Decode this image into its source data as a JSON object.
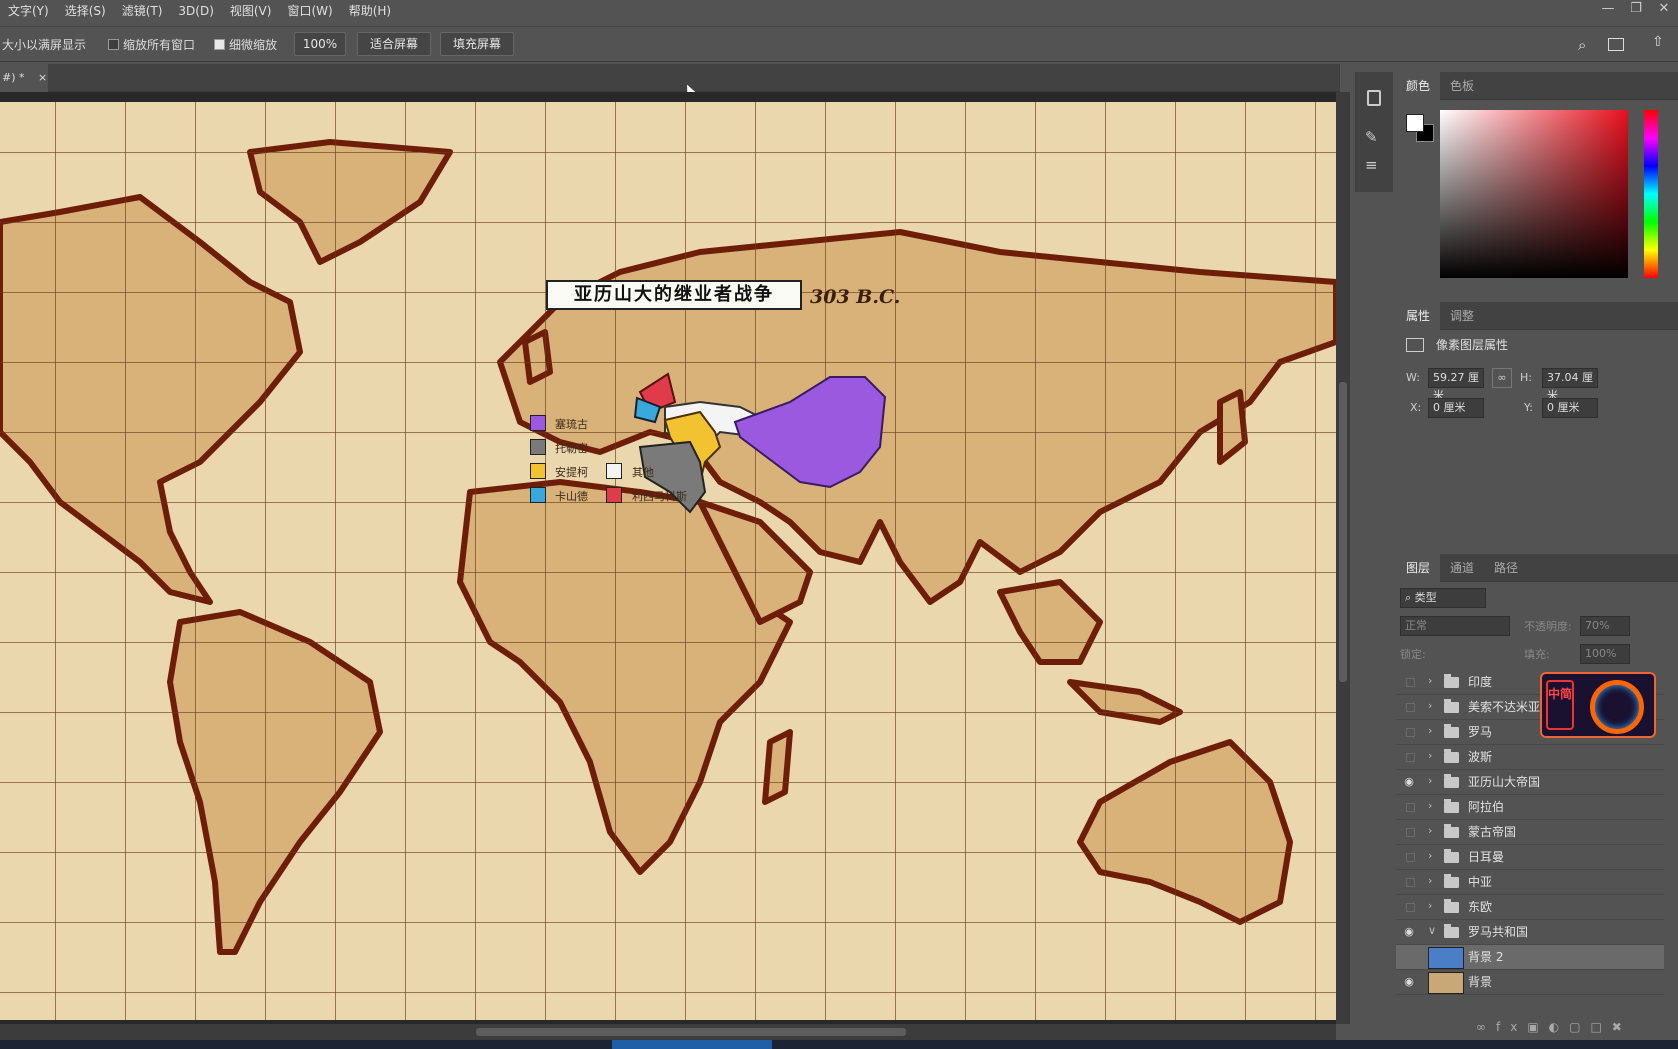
{
  "menu": [
    "文字(Y)",
    "选择(S)",
    "滤镜(T)",
    "3D(D)",
    "视图(V)",
    "窗口(W)",
    "帮助(H)"
  ],
  "window_controls": [
    "—",
    "❐",
    "✕"
  ],
  "options": {
    "resize_windows": "大小以满屏显示",
    "zoom_all": "缩放所有窗口",
    "scrubby": "细微缩放",
    "zoom_value": "100%",
    "fit_screen": "适合屏幕",
    "fill_screen": "填充屏幕"
  },
  "doc_tab": {
    "label": "#) *",
    "close": "×"
  },
  "map": {
    "title": "亚历山大的继业者战争",
    "date": "303 B.C.",
    "legend": [
      {
        "label": "塞琉古",
        "color": "#9b59e0"
      },
      {
        "label": "托勒密",
        "color": "#7a7a7a"
      },
      {
        "label": "安提柯",
        "color": "#f2c230"
      },
      {
        "label": "其他",
        "color": "#f4f4f4"
      },
      {
        "label": "卡山德",
        "color": "#3ba8dc"
      },
      {
        "label": "利西马科斯",
        "color": "#e03b4a"
      }
    ]
  },
  "color_panel": {
    "tabs": [
      "颜色",
      "色板"
    ]
  },
  "props_panel": {
    "tabs": [
      "属性",
      "调整"
    ],
    "heading": "像素图层属性",
    "w_label": "W:",
    "w_value": "59.27 厘米",
    "h_label": "H:",
    "h_value": "37.04 厘米",
    "x_label": "X:",
    "x_value": "0 厘米",
    "y_label": "Y:",
    "y_value": "0 厘米"
  },
  "layers_panel": {
    "tabs": [
      "图层",
      "通道",
      "路径"
    ],
    "filter": "类型",
    "blend": "正常",
    "opacity_label": "不透明度:",
    "opacity_value": "70%",
    "lock_label": "锁定:",
    "fill_label": "填充:",
    "fill_value": "100%",
    "layers": [
      {
        "name": "印度",
        "visible": false,
        "type": "group"
      },
      {
        "name": "美索不达米亚",
        "visible": false,
        "type": "group"
      },
      {
        "name": "罗马",
        "visible": false,
        "type": "group"
      },
      {
        "name": "波斯",
        "visible": false,
        "type": "group"
      },
      {
        "name": "亚历山大帝国",
        "visible": true,
        "type": "group"
      },
      {
        "name": "阿拉伯",
        "visible": false,
        "type": "group"
      },
      {
        "name": "蒙古帝国",
        "visible": false,
        "type": "group"
      },
      {
        "name": "日耳曼",
        "visible": false,
        "type": "group"
      },
      {
        "name": "中亚",
        "visible": false,
        "type": "group"
      },
      {
        "name": "东欧",
        "visible": false,
        "type": "group"
      },
      {
        "name": "罗马共和国",
        "visible": true,
        "type": "group-open"
      },
      {
        "name": "背景 2",
        "visible": false,
        "type": "layer",
        "selected": true
      },
      {
        "name": "背景",
        "visible": true,
        "type": "layer"
      }
    ]
  },
  "watermark": {
    "text": "中简"
  }
}
